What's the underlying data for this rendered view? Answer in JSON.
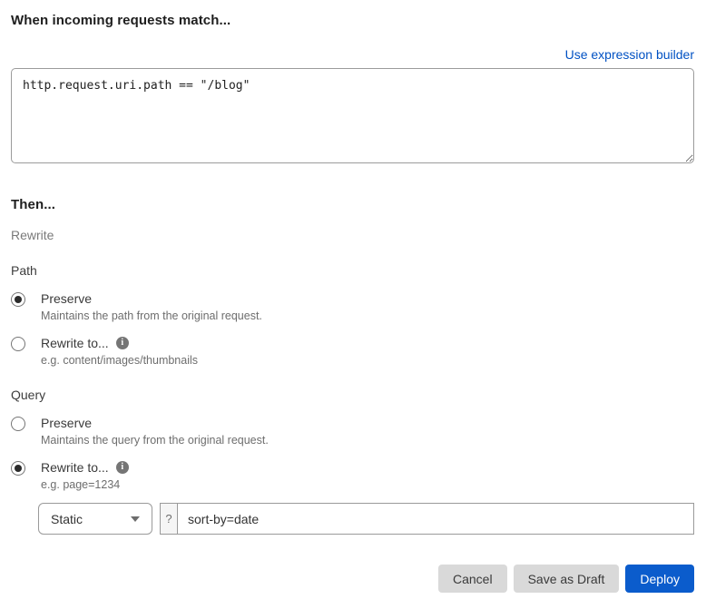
{
  "match_section": {
    "title": "When incoming requests match...",
    "builder_link": "Use expression builder",
    "expression_value": "http.request.uri.path == \"/blog\""
  },
  "then_section": {
    "title": "Then...",
    "subtitle": "Rewrite"
  },
  "path_section": {
    "label": "Path",
    "options": [
      {
        "label": "Preserve",
        "description": "Maintains the path from the original request.",
        "selected": true,
        "has_info": false
      },
      {
        "label": "Rewrite to...",
        "description": "e.g. content/images/thumbnails",
        "selected": false,
        "has_info": true
      }
    ]
  },
  "query_section": {
    "label": "Query",
    "options": [
      {
        "label": "Preserve",
        "description": "Maintains the query from the original request.",
        "selected": false,
        "has_info": false
      },
      {
        "label": "Rewrite to...",
        "description": "e.g. page=1234",
        "selected": true,
        "has_info": true
      }
    ]
  },
  "query_rewrite": {
    "type_selected": "Static",
    "prefix": "?",
    "value": "sort-by=date"
  },
  "icons": {
    "info_glyph": "i"
  },
  "footer": {
    "cancel_label": "Cancel",
    "save_draft_label": "Save as Draft",
    "deploy_label": "Deploy"
  },
  "colors": {
    "link_blue": "#0051c3",
    "deploy_blue": "#0b5ccc",
    "secondary_button_gray": "#d9d9d9",
    "radio_dot": "#2b2b2b",
    "info_icon_gray": "#757575"
  }
}
